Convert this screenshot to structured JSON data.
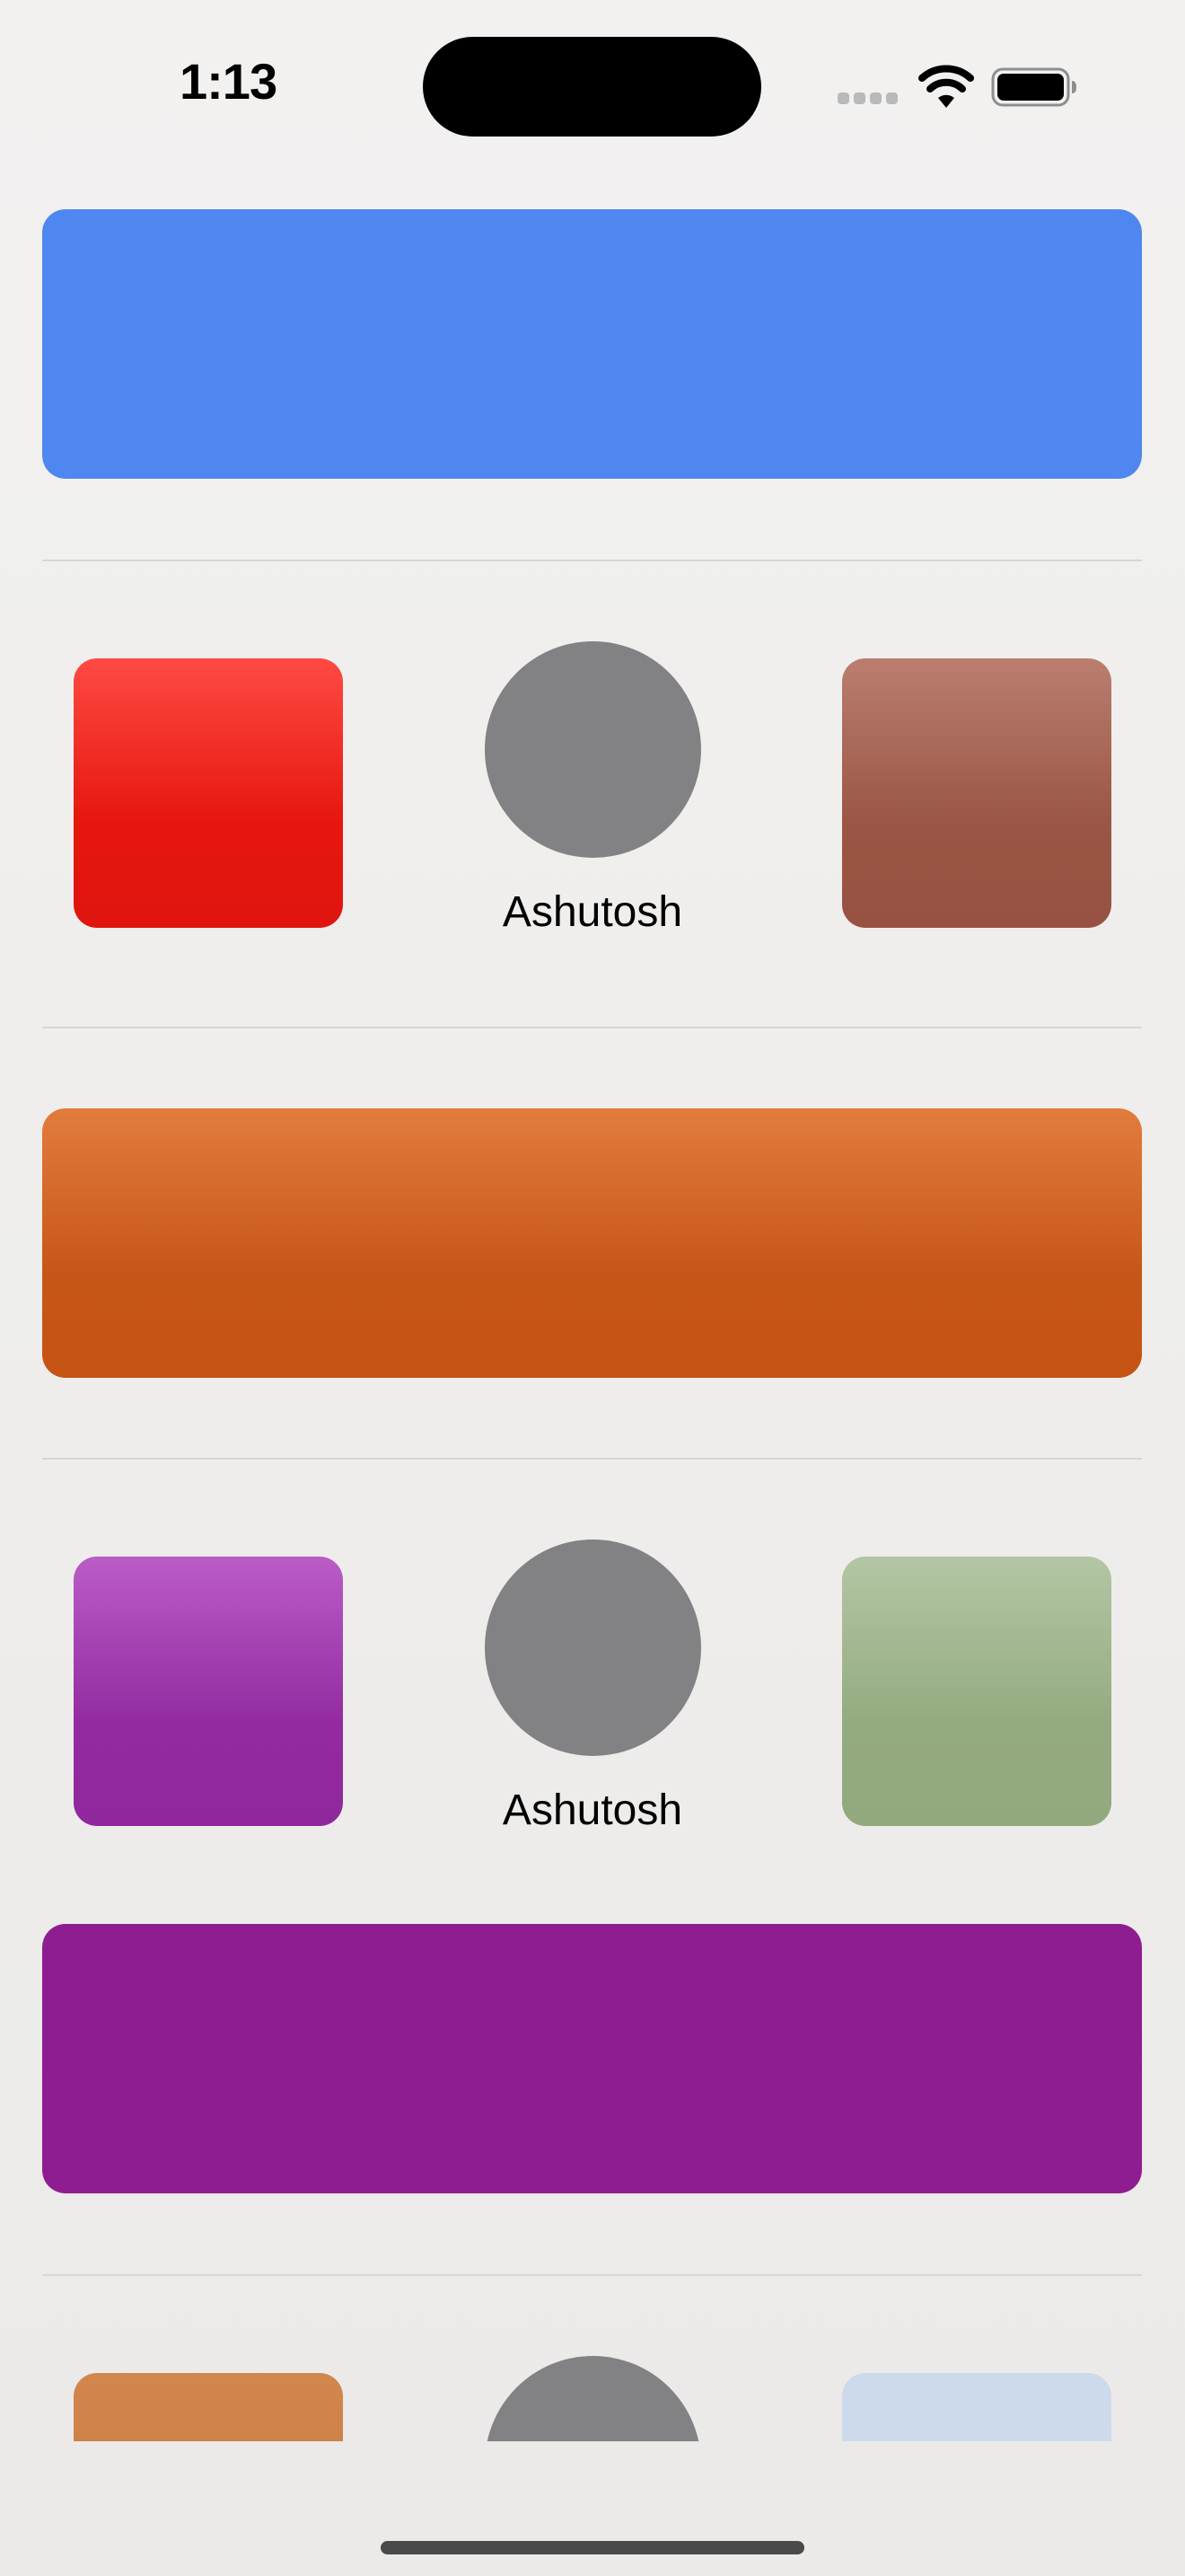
{
  "status_bar": {
    "time": "1:13",
    "signal_icon": "cellular-signal-icon",
    "wifi_icon": "wifi-icon",
    "battery_icon": "battery-icon"
  },
  "colors": {
    "banner_blue": "#4f86ef",
    "banner_orange": "#c65617",
    "banner_purple": "#8e1e90",
    "tile_red": "#e5160e",
    "tile_brown": "#9a5545",
    "tile_violet": "#922ba0",
    "tile_sage": "#94ab7f",
    "tile_amber": "#c47a3f",
    "tile_pale_blue": "#cddaec",
    "avatar_gray": "#828285"
  },
  "feed": {
    "row_1": {
      "avatar_name": "Ashutosh"
    },
    "row_2": {
      "avatar_name": "Ashutosh"
    }
  }
}
